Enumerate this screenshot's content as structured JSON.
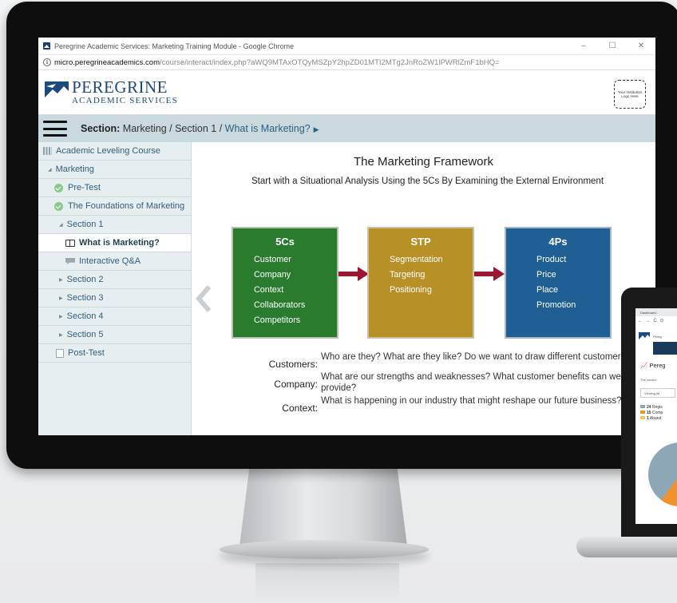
{
  "browser": {
    "window_title": "Peregrine Academic Services: Marketing Training Module - Google Chrome",
    "url_domain": "micro.peregrineacademics.com",
    "url_path": "/course/interact/index.php?aWQ9MTAxOTQyMSZpY2hpZD01MTI2MTg2JnRoZW1lPWRlZmF1bHQ=",
    "controls": {
      "minimize": "–",
      "maximize": "☐",
      "close": "✕"
    }
  },
  "header": {
    "logo_main": "PEREGRINE",
    "logo_sub": "ACADEMIC SERVICES",
    "institution_logo": "Your Institution Logo Here"
  },
  "breadcrumb": {
    "label": "Section:",
    "path": "Marketing / Section 1 /",
    "current": "What is Marketing?",
    "arrow": "▶"
  },
  "sidebar": {
    "items": [
      {
        "label": "Academic Leveling Course"
      },
      {
        "label": "Marketing",
        "marker": "◢"
      },
      {
        "label": "Pre-Test"
      },
      {
        "label": "The Foundations of Marketing"
      },
      {
        "label": "Section 1",
        "marker": "◢"
      },
      {
        "label": "What is Marketing?"
      },
      {
        "label": "Interactive Q&A"
      },
      {
        "label": "Section 2",
        "marker": "▶"
      },
      {
        "label": "Section 3",
        "marker": "▶"
      },
      {
        "label": "Section 4",
        "marker": "▶"
      },
      {
        "label": "Section 5",
        "marker": "▶"
      },
      {
        "label": "Post-Test"
      }
    ]
  },
  "slide": {
    "title": "The Marketing Framework",
    "subtitle": "Start with a Situational Analysis Using the 5Cs By Examining the External Environment",
    "boxes": [
      {
        "heading": "5Cs",
        "items": [
          "Customer",
          "Company",
          "Context",
          "Collaborators",
          "Competitors"
        ],
        "color": "#2b7b2f"
      },
      {
        "heading": "STP",
        "items": [
          "Segmentation",
          "Targeting",
          "Positioning"
        ],
        "color": "#b89028"
      },
      {
        "heading": "4Ps",
        "items": [
          "Product",
          "Price",
          "Place",
          "Promotion"
        ],
        "color": "#1f5f94"
      }
    ],
    "definitions": [
      {
        "term": "Customers:",
        "text": "Who are they? What are they like? Do we want to draw different customers?"
      },
      {
        "term": "Company:",
        "text": "What are our strengths and weaknesses? What customer benefits can we provide?"
      },
      {
        "term": "Context:",
        "text": "What is happening in our industry that might reshape our future business?"
      }
    ]
  },
  "laptop": {
    "tab": "Dashboard -",
    "nav": "← → C ⊙",
    "logo_text": "Pereg",
    "title": "Pereg",
    "desc": "The current",
    "view": "Viewing All",
    "legend": [
      {
        "count": "24",
        "label": "Regis",
        "color": "#8ea7b6"
      },
      {
        "count": "15",
        "label": "Comp",
        "color": "#f0922d"
      },
      {
        "count": "1",
        "label": "Aband",
        "color": "#f2c94c"
      }
    ]
  }
}
